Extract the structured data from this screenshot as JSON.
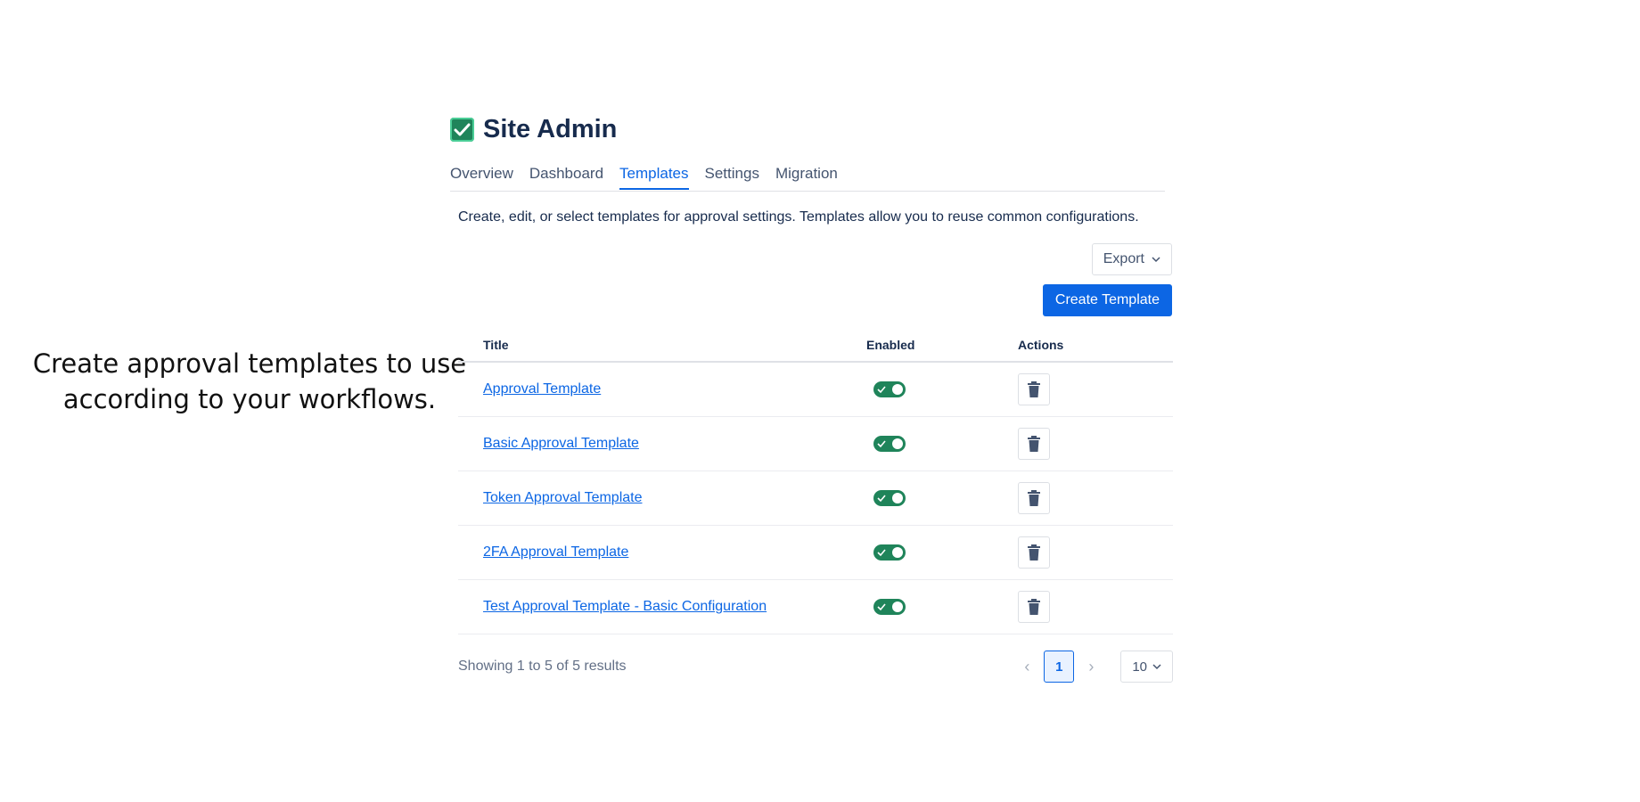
{
  "caption": {
    "line1": "Create approval templates to use",
    "line2": "according to your workflows."
  },
  "header": {
    "title": "Site Admin",
    "logo_icon": "checkbox-checked-icon"
  },
  "tabs": [
    {
      "label": "Overview",
      "active": false
    },
    {
      "label": "Dashboard",
      "active": false
    },
    {
      "label": "Templates",
      "active": true
    },
    {
      "label": "Settings",
      "active": false
    },
    {
      "label": "Migration",
      "active": false
    }
  ],
  "description": "Create, edit, or select templates for approval settings. Templates allow you to reuse common configurations.",
  "toolbar": {
    "export_label": "Export",
    "create_label": "Create Template"
  },
  "table": {
    "columns": [
      "Title",
      "Enabled",
      "Actions"
    ],
    "rows": [
      {
        "title": "Approval Template",
        "enabled": true
      },
      {
        "title": "Basic Approval Template",
        "enabled": true
      },
      {
        "title": "Token Approval Template",
        "enabled": true
      },
      {
        "title": "2FA Approval Template",
        "enabled": true
      },
      {
        "title": "Test Approval Template - Basic Configuration",
        "enabled": true
      }
    ]
  },
  "footer": {
    "results_text": "Showing 1 to 5 of 5 results",
    "current_page": "1",
    "page_size": "10"
  },
  "colors": {
    "primary": "#0c66e4",
    "toggle_on": "#1f845a",
    "text": "#172b4d"
  }
}
